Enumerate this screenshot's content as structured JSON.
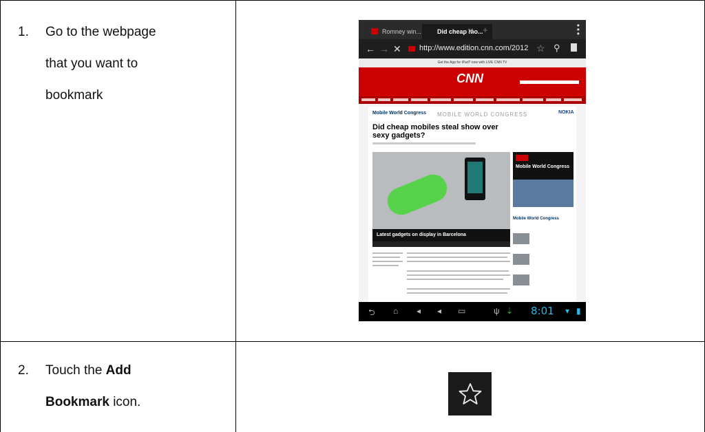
{
  "steps": [
    {
      "number": "1.",
      "lines": [
        "Go to the webpage",
        "that you want to",
        "bookmark"
      ]
    },
    {
      "number": "2.",
      "pre": "Touch the ",
      "bold1": "Add",
      "bold2": "Bookmark",
      "post": " icon."
    }
  ],
  "browser": {
    "tabs": [
      "Romney win...",
      "Did cheap mo..."
    ],
    "url": "http://www.edition.cnn.com/2012",
    "promo": "Get the App for iPad? now with LIVE CNN TV",
    "logo": "CNN",
    "section": "Mobile World Congress",
    "banner": "MOBILE WORLD CONGRESS",
    "sponsor": "NOKIA",
    "headline": "Did cheap mobiles steal show over sexy gadgets?",
    "caption": "Latest gadgets on display in Barcelona",
    "sidebar_title": "Mobile World Congress",
    "sidebar_head": "Mobile World Congress",
    "clock": "8:01"
  },
  "icons": {
    "add_bookmark": "star-outline-icon"
  }
}
